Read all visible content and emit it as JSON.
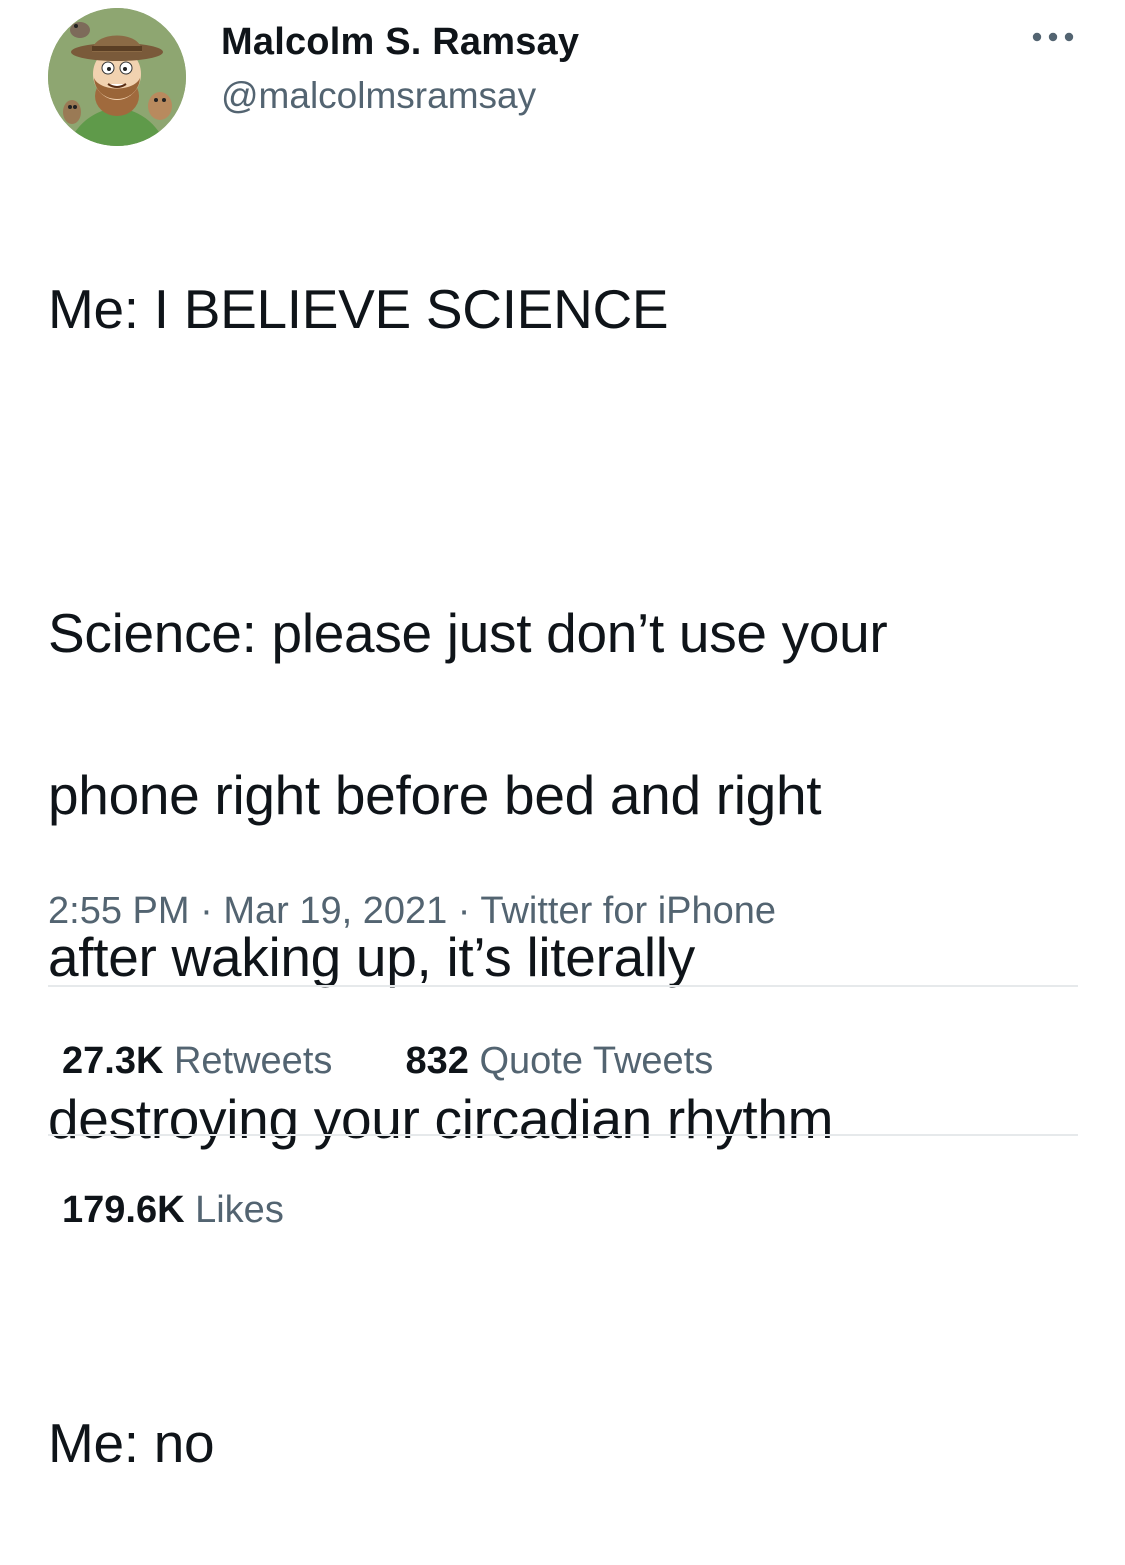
{
  "author": {
    "display_name": "Malcolm S. Ramsay",
    "handle": "@malcolmsramsay",
    "avatar_icon": "cartoon-avatar"
  },
  "more_icon": "more-horizontal-icon",
  "tweet": {
    "lines": [
      "Me: I BELIEVE SCIENCE",
      "",
      "Science: please just don’t use your",
      "phone right before bed and right",
      "after waking up, it’s literally",
      "destroying your circadian rhythm",
      "",
      "Me: no"
    ]
  },
  "meta": {
    "time": "2:55 PM",
    "separator": " · ",
    "date": "Mar 19, 2021",
    "source": "Twitter for iPhone"
  },
  "stats": {
    "retweets_count": "27.3K",
    "retweets_label": "Retweets",
    "quotes_count": "832",
    "quotes_label": "Quote Tweets",
    "likes_count": "179.6K",
    "likes_label": "Likes"
  },
  "colors": {
    "text_primary": "#0f1419",
    "text_secondary": "#536471",
    "divider": "#e6e9eb"
  }
}
